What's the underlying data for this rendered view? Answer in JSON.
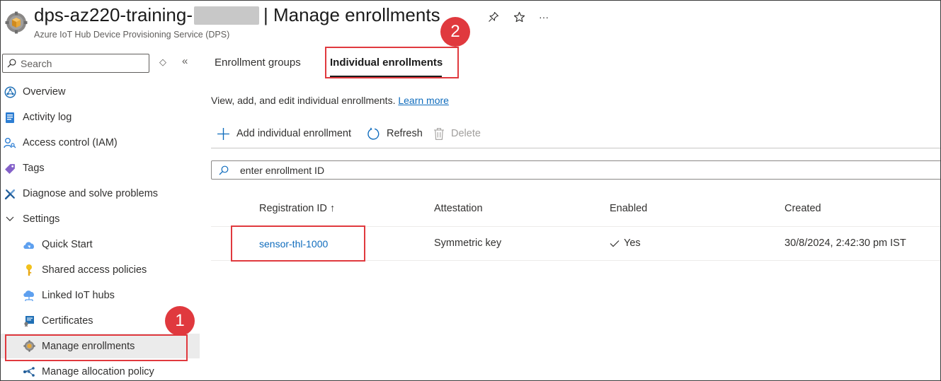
{
  "header": {
    "title_prefix": "dps-az220-training-",
    "title_suffix": "| Manage enrollments",
    "subtitle": "Azure IoT Hub Device Provisioning Service (DPS)",
    "pin_icon": "pin-icon",
    "favorite_icon": "star-icon",
    "more_label": "···"
  },
  "sidebar": {
    "search_placeholder": "Search",
    "items": [
      {
        "label": "Overview",
        "icon": "overview-icon"
      },
      {
        "label": "Activity log",
        "icon": "activity-log-icon"
      },
      {
        "label": "Access control (IAM)",
        "icon": "iam-icon"
      },
      {
        "label": "Tags",
        "icon": "tag-icon"
      },
      {
        "label": "Diagnose and solve problems",
        "icon": "wrench-icon"
      },
      {
        "label": "Settings",
        "icon": "chevron-down-icon"
      },
      {
        "label": "Quick Start",
        "icon": "cloud-icon"
      },
      {
        "label": "Shared access policies",
        "icon": "key-icon"
      },
      {
        "label": "Linked IoT hubs",
        "icon": "linked-hub-icon"
      },
      {
        "label": "Certificates",
        "icon": "certificate-icon"
      },
      {
        "label": "Manage enrollments",
        "icon": "gear-icon"
      },
      {
        "label": "Manage allocation policy",
        "icon": "allocation-icon"
      }
    ]
  },
  "tabs": [
    {
      "label": "Enrollment groups"
    },
    {
      "label": "Individual enrollments",
      "selected": true
    }
  ],
  "description": {
    "text": "View, add, and edit individual enrollments.",
    "link": "Learn more"
  },
  "toolbar": {
    "add_label": "Add individual enrollment",
    "refresh_label": "Refresh",
    "delete_label": "Delete"
  },
  "filter": {
    "placeholder": "enter enrollment ID"
  },
  "table": {
    "columns": [
      "Registration ID ↑",
      "Attestation",
      "Enabled",
      "Created"
    ],
    "rows": [
      {
        "registration_id": "sensor-thl-1000",
        "attestation": "Symmetric key",
        "enabled": "Yes",
        "created": "30/8/2024, 2:42:30 pm IST"
      }
    ]
  },
  "callouts": {
    "one": "1",
    "two": "2"
  },
  "colors": {
    "accent_link": "#0f6cbd",
    "callout_red": "#e0393e",
    "active_item_bg": "#ebebeb"
  }
}
